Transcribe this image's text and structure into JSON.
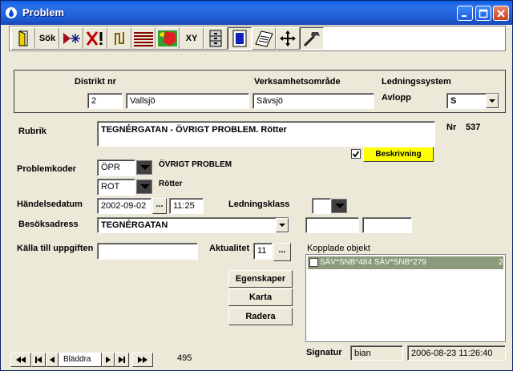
{
  "window": {
    "title": "Problem"
  },
  "toolbar": {
    "sok_label": "Sök",
    "xy_label": "XY"
  },
  "panel": {
    "distrikt_label": "Distrikt nr",
    "distrikt_nr": "2",
    "distrikt_name": "Vallsjö",
    "verksamhet_label": "Verksamhetsområde",
    "verksamhet_value": "Sävsjö",
    "ledningssystem_label": "Ledningssystem",
    "ledningssystem_type": "Avlopp",
    "ledningssystem_value": "S"
  },
  "form": {
    "rubrik_label": "Rubrik",
    "rubrik_value": "TEGNÉRGATAN  -  ÖVRIGT PROBLEM. Rötter",
    "nr_label": "Nr",
    "nr_value": "537",
    "beskrivning_label": "Beskrivning",
    "problemkoder_label": "Problemkoder",
    "kod1": "ÖPR",
    "kod1_desc": "ÖVRIGT PROBLEM",
    "kod2": "ROT",
    "kod2_desc": "Rötter",
    "handelse_label": "Händelsedatum",
    "handelse_date": "2002-09-02",
    "handelse_time": "11:25",
    "date_btn": "...",
    "ledningsklass_label": "Ledningsklass",
    "besok_label": "Besöksadress",
    "besok_value": "TEGNÉRGATAN",
    "kalla_label": "Källa till uppgiften",
    "aktualitet_label": "Aktualitet",
    "aktualitet_value": "11",
    "aktualitet_btn": "...",
    "kopplade_label": "Kopplade objekt",
    "kopplade_items": [
      "SÄV*SNB*484   SÄV*SNB*279",
      "2"
    ]
  },
  "actions": {
    "egenskaper": "Egenskaper",
    "karta": "Karta",
    "radera": "Radera"
  },
  "footer": {
    "nav_label": "Bläddra",
    "count": "495",
    "signatur_label": "Signatur",
    "signatur_value": "bian",
    "timestamp": "2006-08-23 11:26:40"
  }
}
